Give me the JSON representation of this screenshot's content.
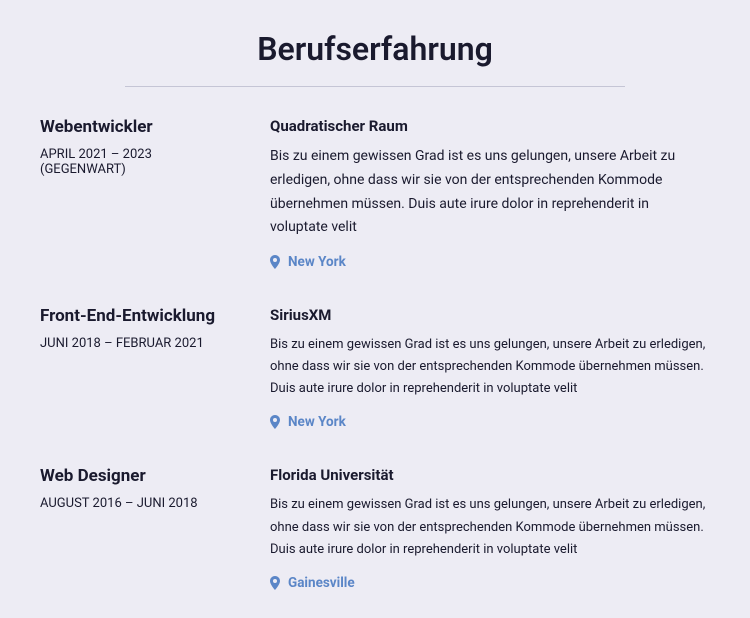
{
  "title": "Berufserfahrung",
  "entries": [
    {
      "role": "Webentwickler",
      "dates": "APRIL 2021 – 2023 (GEGENWART)",
      "company": "Quadratischer Raum",
      "desc": "Bis zu einem gewissen Grad ist es uns gelungen, unsere Arbeit zu erledigen, ohne dass wir sie von der entsprechenden Kommode übernehmen müssen. Duis aute irure dolor in reprehenderit in voluptate velit",
      "location": "New York"
    },
    {
      "role": "Front-End-Entwicklung",
      "dates": "JUNI 2018 – FEBRUAR 2021",
      "company": "SiriusXM",
      "desc": "Bis zu einem gewissen Grad ist es uns gelungen, unsere Arbeit zu erledigen, ohne dass wir sie von der entsprechenden Kommode übernehmen müssen. Duis aute irure dolor in reprehenderit in voluptate velit",
      "location": "New York"
    },
    {
      "role": "Web Designer",
      "dates": "AUGUST 2016 – JUNI 2018",
      "company": "Florida Universität",
      "desc": "Bis zu einem gewissen Grad ist es uns gelungen, unsere Arbeit zu erledigen, ohne dass wir sie von der entsprechenden Kommode übernehmen müssen. Duis aute irure dolor in reprehenderit in voluptate velit",
      "location": "Gainesville"
    }
  ]
}
